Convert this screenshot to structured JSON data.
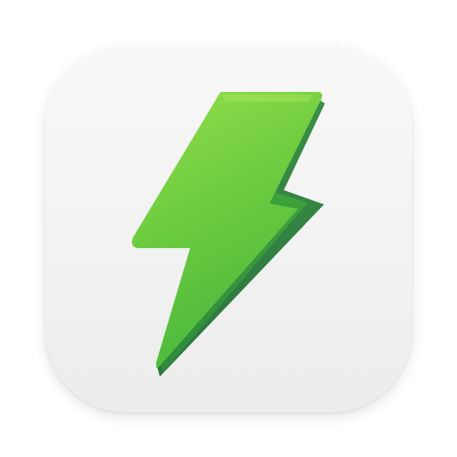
{
  "icon": {
    "name": "lightning-bolt-icon",
    "tile_color": "#f2f2f2",
    "bolt_colors": {
      "light": "#8fdc4a",
      "main": "#5cc23a",
      "mid": "#3ea83a",
      "dark": "#2f8a43"
    }
  }
}
